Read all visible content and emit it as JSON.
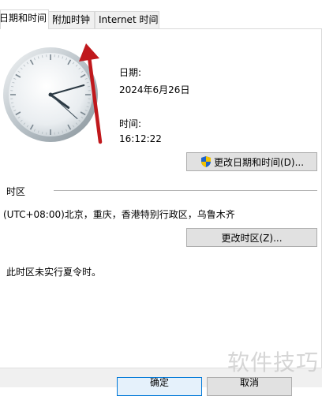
{
  "tabs": [
    {
      "label": "日期和时间",
      "visible_label": "日期和时间",
      "active": true
    },
    {
      "label": "附加时钟",
      "active": false
    },
    {
      "label": "Internet 时间",
      "active": false
    }
  ],
  "clock_time": "16:12:22",
  "date": {
    "label": "日期:",
    "value": "2024年6月26日"
  },
  "time": {
    "label": "时间:",
    "value": "16:12:22"
  },
  "change_datetime_button": "更改日期和时间(D)...",
  "timezone": {
    "group_label": "时区",
    "value": "(UTC+08:00)北京，重庆，香港特别行政区，乌鲁木齐",
    "change_button": "更改时区(Z)..."
  },
  "dst_note": "此时区未实行夏令时。",
  "dialog_buttons": {
    "ok": "确定",
    "cancel": "取消"
  },
  "watermark": "软件技巧",
  "colors": {
    "annotation_arrow": "#c0181c",
    "ok_border": "#0078d7"
  }
}
